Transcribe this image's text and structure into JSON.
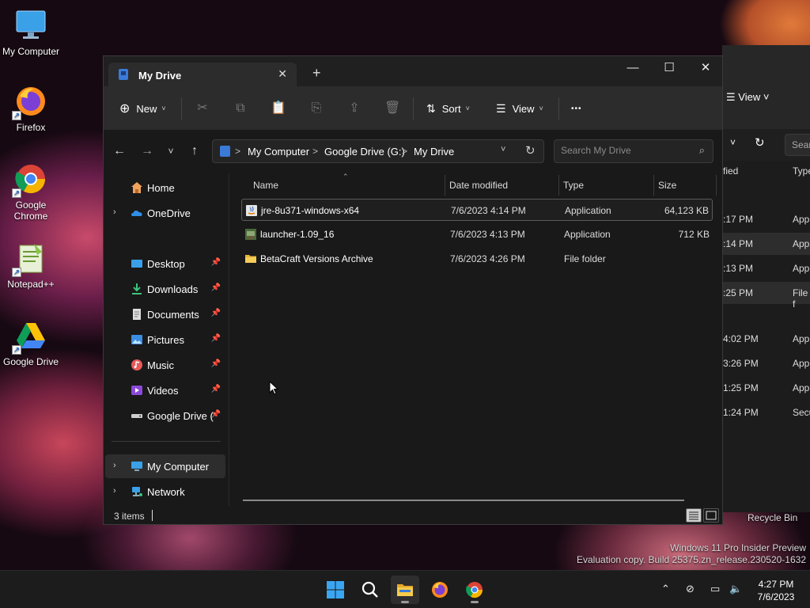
{
  "desktop": {
    "icons": [
      {
        "label": "My Computer",
        "icon": "monitor-icon"
      },
      {
        "label": "Firefox",
        "icon": "firefox-icon"
      },
      {
        "label": "Google Chrome",
        "icon": "chrome-icon"
      },
      {
        "label": "Notepad++",
        "icon": "notepad-plus-plus-icon"
      },
      {
        "label": "Google Drive",
        "icon": "google-drive-icon"
      }
    ],
    "recycle_bin": "Recycle Bin",
    "watermark": {
      "line1": "Windows 11 Pro Insider Preview",
      "line2": "Evaluation copy. Build 25375.zn_release.230520-1632"
    }
  },
  "background_window": {
    "view_label": "View",
    "search_placeholder": "Searc",
    "header_date": "fied",
    "header_type": "Type",
    "rows": [
      {
        "time": ":17 PM",
        "type": "App"
      },
      {
        "time": ":14 PM",
        "type": "App"
      },
      {
        "time": ":13 PM",
        "type": "App"
      },
      {
        "time": ":25 PM",
        "type": "File f"
      },
      {
        "time": "4:02 PM",
        "type": "App"
      },
      {
        "time": "3:26 PM",
        "type": "App"
      },
      {
        "time": "1:25 PM",
        "type": "App"
      },
      {
        "time": "1:24 PM",
        "type": "Secu"
      }
    ]
  },
  "window": {
    "tab_title": "My Drive",
    "toolbar": {
      "new_label": "New",
      "sort_label": "Sort",
      "view_label": "View",
      "more_label": "•••"
    },
    "address": {
      "crumbs": [
        "My Computer",
        "Google Drive (G:)",
        "My Drive"
      ],
      "separator": ">"
    },
    "search_placeholder": "Search My Drive",
    "sidebar": {
      "items": [
        {
          "label": "Home",
          "icon": "home-icon"
        },
        {
          "label": "OneDrive",
          "icon": "onedrive-icon"
        },
        {
          "label": "Desktop",
          "icon": "desktop-icon"
        },
        {
          "label": "Downloads",
          "icon": "downloads-icon"
        },
        {
          "label": "Documents",
          "icon": "documents-icon"
        },
        {
          "label": "Pictures",
          "icon": "pictures-icon"
        },
        {
          "label": "Music",
          "icon": "music-icon"
        },
        {
          "label": "Videos",
          "icon": "videos-icon"
        },
        {
          "label": "Google Drive (G:)",
          "icon": "drive-icon"
        },
        {
          "label": "My Computer",
          "icon": "monitor-icon"
        },
        {
          "label": "Network",
          "icon": "network-icon"
        }
      ]
    },
    "columns": {
      "name": "Name",
      "date": "Date modified",
      "type": "Type",
      "size": "Size"
    },
    "files": [
      {
        "name": "jre-8u371-windows-x64",
        "date": "7/6/2023 4:14 PM",
        "type": "Application",
        "size": "64,123 KB",
        "icon": "installer-icon"
      },
      {
        "name": "launcher-1.09_16",
        "date": "7/6/2023 4:13 PM",
        "type": "Application",
        "size": "712 KB",
        "icon": "app-icon"
      },
      {
        "name": "BetaCraft Versions Archive",
        "date": "7/6/2023 4:26 PM",
        "type": "File folder",
        "size": "",
        "icon": "folder-icon"
      }
    ],
    "status": "3 items"
  },
  "taskbar": {
    "apps": [
      "start-icon",
      "search-icon",
      "file-explorer-icon",
      "firefox-icon",
      "chrome-icon"
    ],
    "clock": {
      "time": "4:27 PM",
      "date": "7/6/2023"
    }
  },
  "colors": {
    "accent": "#3a7ad9",
    "folder": "#f2c94c",
    "window_bg": "#191919",
    "toolbar_bg": "#2c2c2c"
  }
}
